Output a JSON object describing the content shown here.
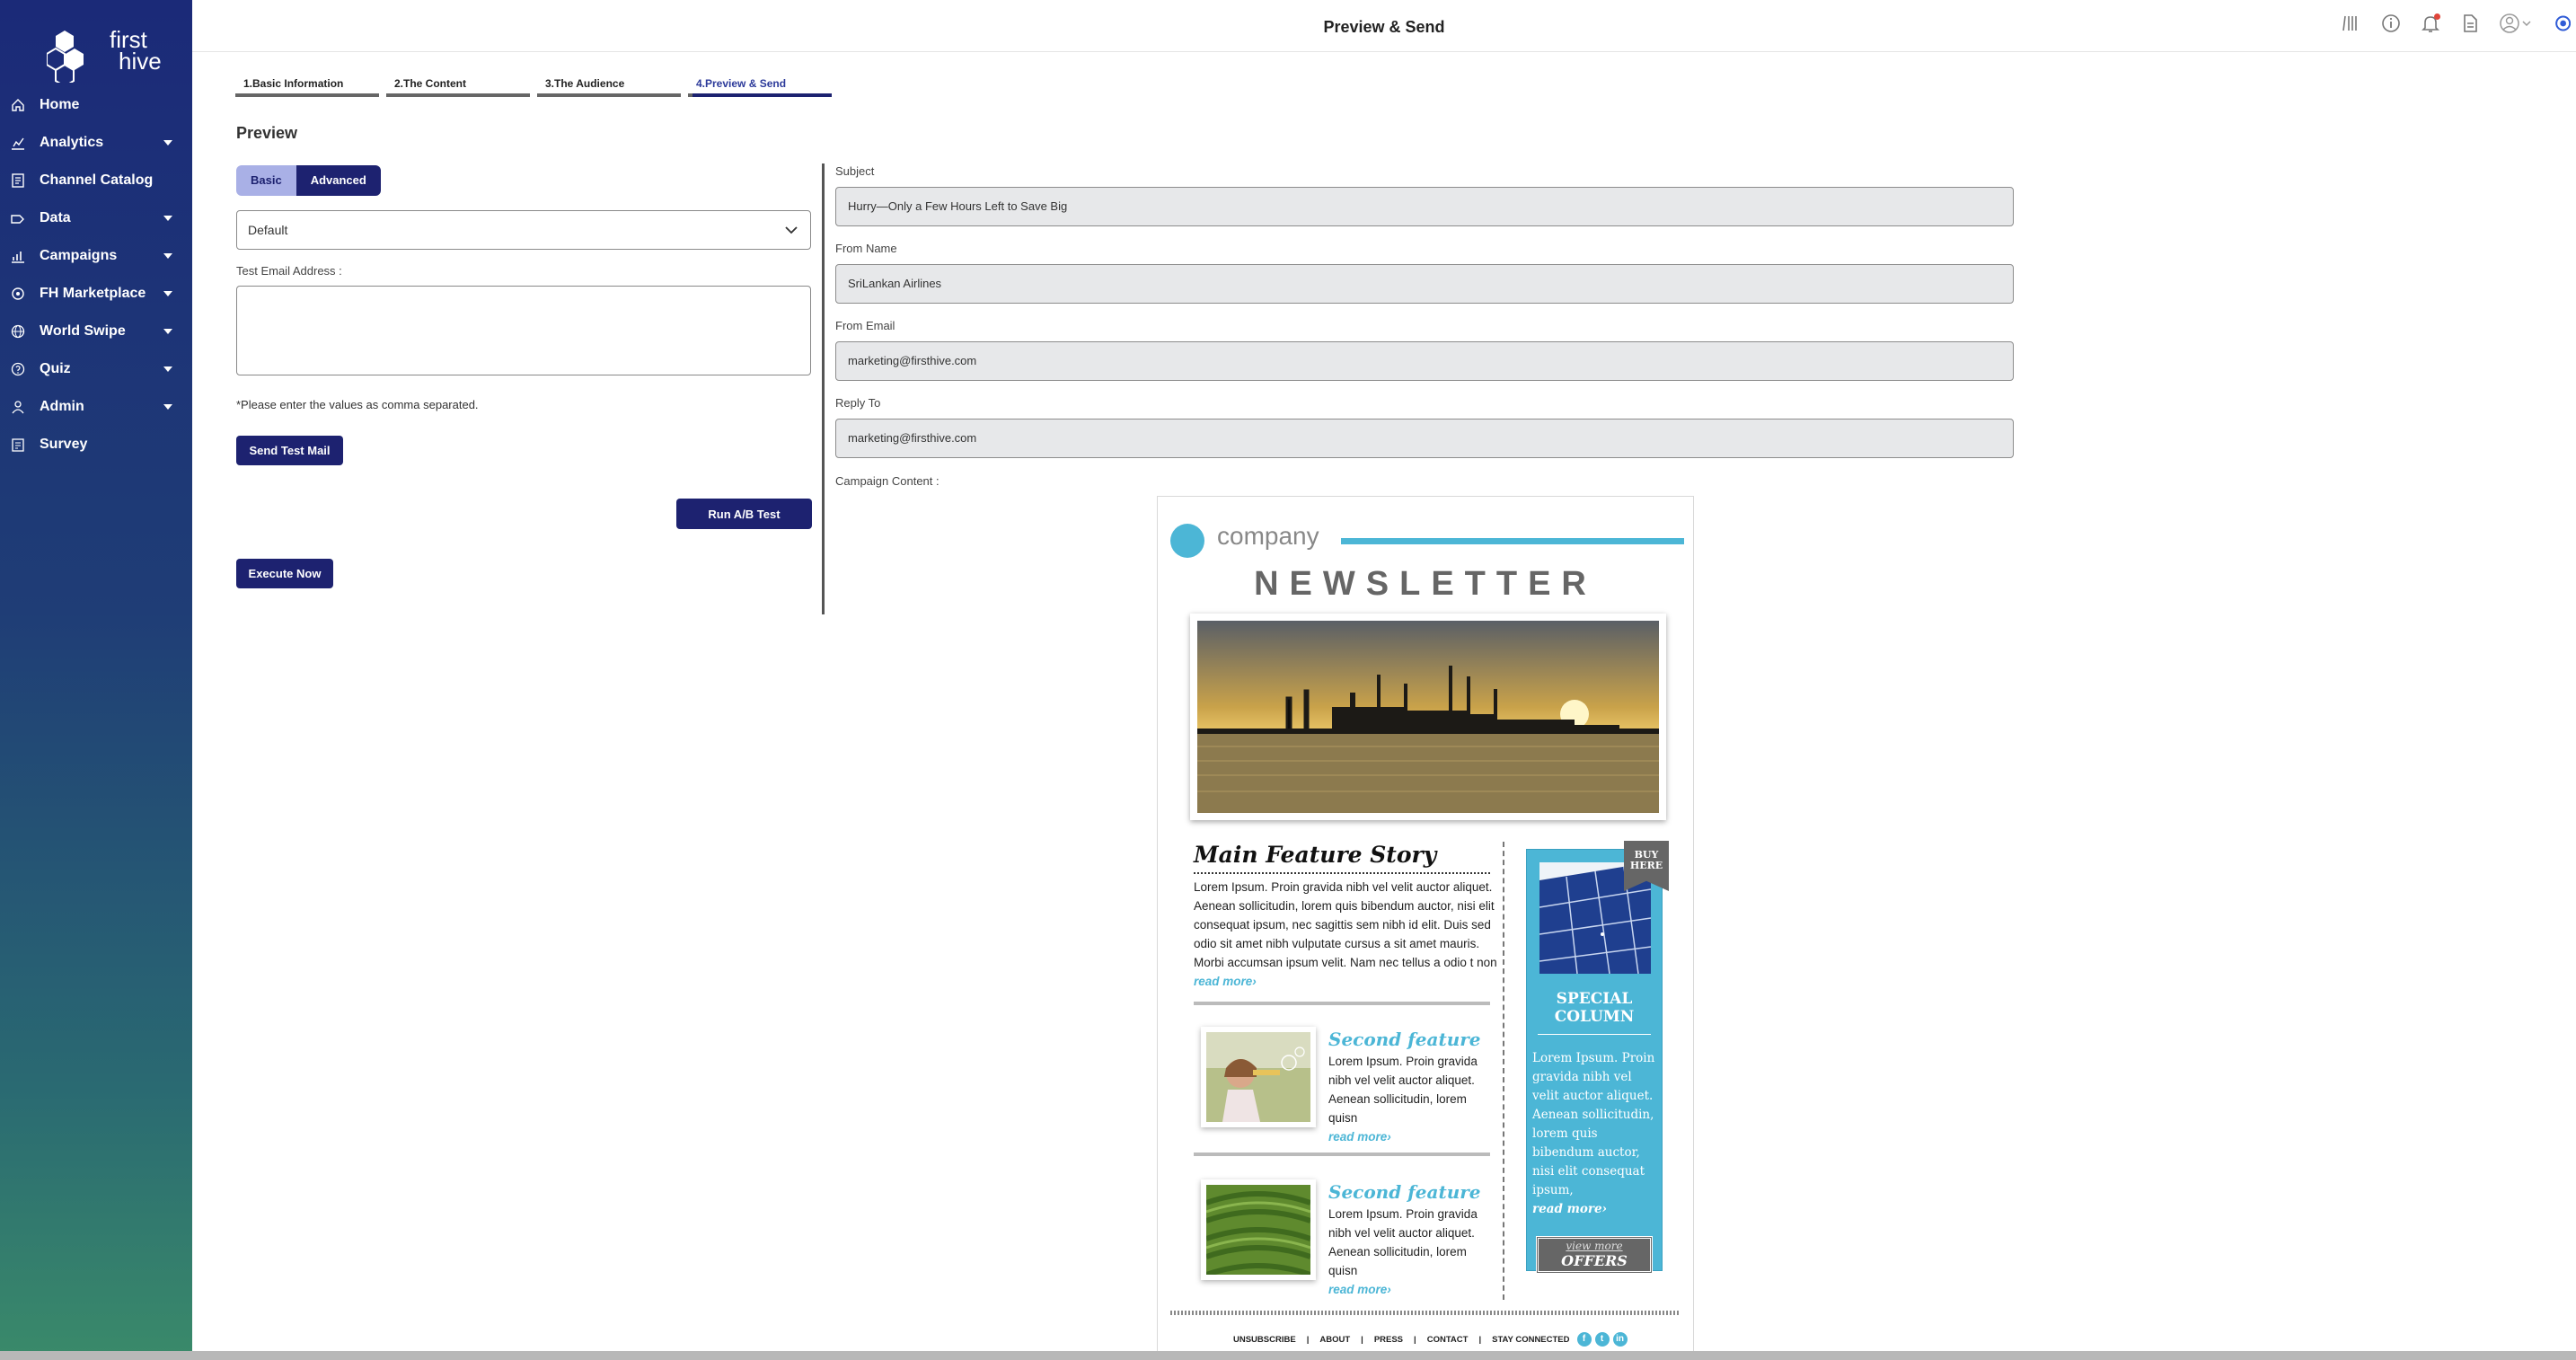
{
  "app": {
    "brand_name": "first hive",
    "brand_line1": "first",
    "brand_line2": "hive",
    "page_title": "Preview & Send"
  },
  "sidebar": {
    "items": [
      {
        "label": "Home",
        "icon": "home-icon",
        "has_caret": false
      },
      {
        "label": "Analytics",
        "icon": "analytics-icon",
        "has_caret": true
      },
      {
        "label": "Channel Catalog",
        "icon": "catalog-icon",
        "has_caret": false
      },
      {
        "label": "Data",
        "icon": "data-icon",
        "has_caret": true
      },
      {
        "label": "Campaigns",
        "icon": "campaigns-icon",
        "has_caret": true
      },
      {
        "label": "FH Marketplace",
        "icon": "marketplace-icon",
        "has_caret": true
      },
      {
        "label": "World Swipe",
        "icon": "globe-icon",
        "has_caret": true
      },
      {
        "label": "Quiz",
        "icon": "quiz-icon",
        "has_caret": true
      },
      {
        "label": "Admin",
        "icon": "admin-icon",
        "has_caret": true
      },
      {
        "label": "Survey",
        "icon": "survey-icon",
        "has_caret": false
      }
    ]
  },
  "steps": [
    {
      "label": "1.Basic Information",
      "active": false
    },
    {
      "label": "2.The Content",
      "active": false
    },
    {
      "label": "3.The Audience",
      "active": false
    },
    {
      "label": "4.Preview & Send",
      "active": true
    }
  ],
  "preview": {
    "heading": "Preview",
    "mode_basic": "Basic",
    "mode_advanced": "Advanced",
    "template_select": "Default",
    "test_email_label": "Test Email Address :",
    "test_email_value": "",
    "hint": "*Please enter the values as comma separated.",
    "send_test_label": "Send Test Mail",
    "run_ab_label": "Run A/B Test",
    "execute_label": "Execute Now"
  },
  "form": {
    "subject_label": "Subject",
    "subject": "Hurry—Only a Few Hours Left to Save Big",
    "from_name_label": "From Name",
    "from_name": "SriLankan Airlines",
    "from_email_label": "From Email",
    "from_email": "marketing@firsthive.com",
    "reply_to_label": "Reply To",
    "reply_to": "marketing@firsthive.com",
    "campaign_content_label": "Campaign Content :"
  },
  "newsletter": {
    "company": "company",
    "title": "NEWSLETTER",
    "main_title": "Main Feature Story",
    "main_body": "Lorem Ipsum. Proin gravida nibh vel velit auctor aliquet. Aenean sollicitudin, lorem quis bibendum auctor, nisi elit consequat ipsum, nec sagittis sem nibh id elit. Duis sed odio sit amet nibh vulputate cursus a sit amet mauris. Morbi accumsan ipsum velit. Nam nec tellus a odio t non",
    "read_more": "read more›",
    "second1_title": "Second feature",
    "second1_body": "Lorem Ipsum. Proin gravida nibh vel velit auctor aliquet. Aenean sollicitudin, lorem quisn",
    "second2_title": "Second feature",
    "second2_body": "Lorem Ipsum. Proin gravida nibh vel velit auctor aliquet. Aenean sollicitudin, lorem quisn",
    "ribbon_line1": "BUY",
    "ribbon_line2": "HERE",
    "special_line1": "SPECIAL",
    "special_line2": "COLUMN",
    "special_body": "Lorem Ipsum. Proin gravida nibh vel velit auctor aliquet. Aenean sollicitudin, lorem quis bibendum auctor, nisi elit consequat ipsum,",
    "view_more": "view more",
    "offers": "OFFERS",
    "footer": [
      "UNSUBSCRIBE",
      "ABOUT",
      "PRESS",
      "CONTACT",
      "STAY CONNECTED"
    ],
    "accent_color": "#4cb6d6"
  },
  "colors": {
    "primary": "#1d2270",
    "accent": "#4cb6d6"
  }
}
